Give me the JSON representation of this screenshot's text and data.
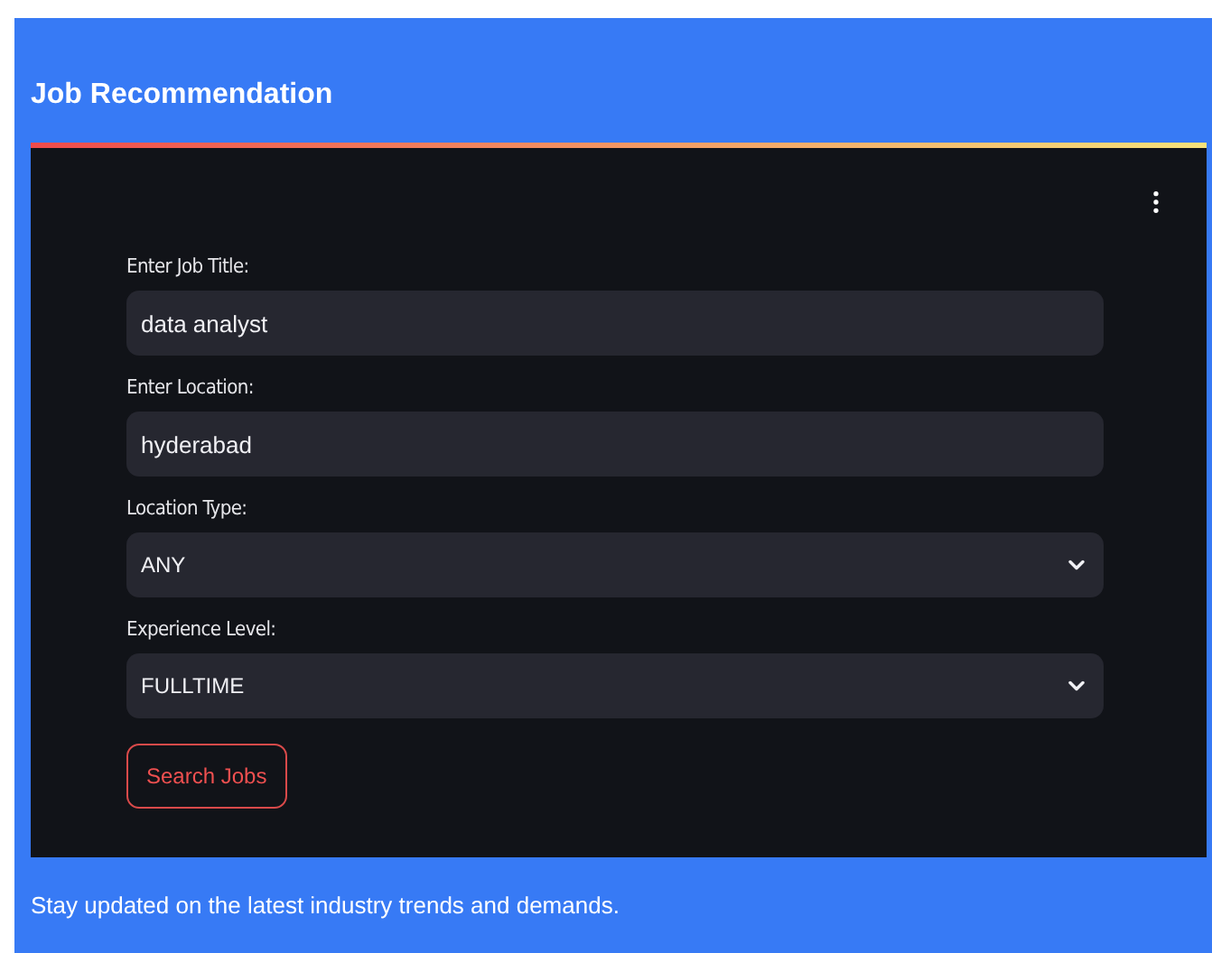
{
  "title": "Job Recommendation",
  "fields": [
    {
      "kind": "text",
      "label": "Enter Job Title:",
      "value": "data analyst"
    },
    {
      "kind": "text",
      "label": "Enter Location:",
      "value": "hyderabad"
    },
    {
      "kind": "select",
      "label": "Location Type:",
      "value": "ANY"
    },
    {
      "kind": "select",
      "label": "Experience Level:",
      "value": "FULLTIME"
    }
  ],
  "button": "Search Jobs",
  "footer": "Stay updated on the latest industry trends and demands."
}
